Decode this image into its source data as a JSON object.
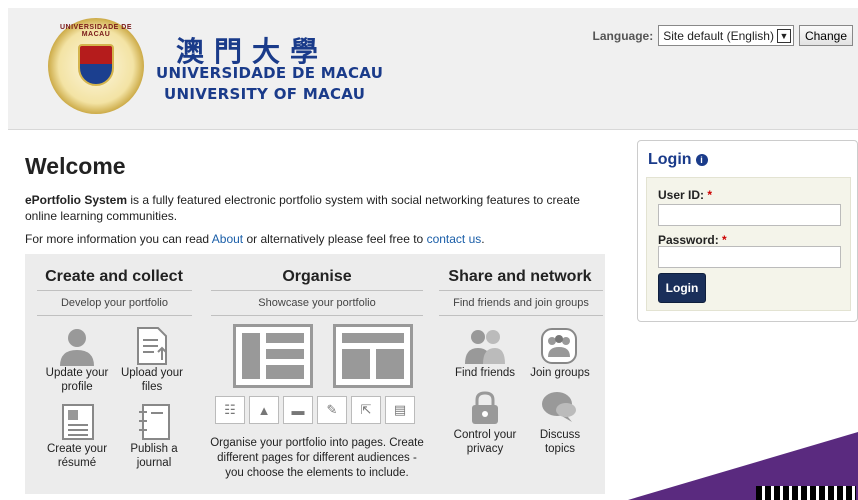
{
  "header": {
    "seal_text": "UNIVERSIDADE DE MACAU",
    "chinese_name": "澳門大學",
    "name_pt": "UNIVERSIDADE DE MACAU",
    "name_en": "UNIVERSITY OF MACAU"
  },
  "language": {
    "label": "Language:",
    "selected": "Site default (English)",
    "change_label": "Change"
  },
  "main": {
    "title": "Welcome",
    "intro_bold": "ePortfolio System",
    "intro_rest": " is a fully featured electronic portfolio system with social networking features to create online learning communities.",
    "info_prefix": "For more information you can read ",
    "about_link": "About",
    "info_middle": " or alternatively please feel free to ",
    "contact_link": "contact us",
    "info_suffix": "."
  },
  "features": {
    "create": {
      "title": "Create and collect",
      "subtitle": "Develop your portfolio",
      "items": [
        "Update your profile",
        "Upload your files",
        "Create your résumé",
        "Publish a journal"
      ]
    },
    "organise": {
      "title": "Organise",
      "subtitle": "Showcase your portfolio",
      "description": "Organise your portfolio into pages. Create different pages for different audiences - you choose the elements to include."
    },
    "share": {
      "title": "Share and network",
      "subtitle": "Find friends and join groups",
      "items": [
        "Find friends",
        "Join groups",
        "Control your privacy",
        "Discuss topics"
      ]
    }
  },
  "login": {
    "title": "Login",
    "user_label": "User ID:",
    "password_label": "Password:",
    "required_marker": "*",
    "button_label": "Login"
  },
  "colors": {
    "brand_blue": "#1a3b8a",
    "login_button": "#1a2f5a",
    "link": "#1a5ea8",
    "accent_purple": "#5a2a7f"
  }
}
